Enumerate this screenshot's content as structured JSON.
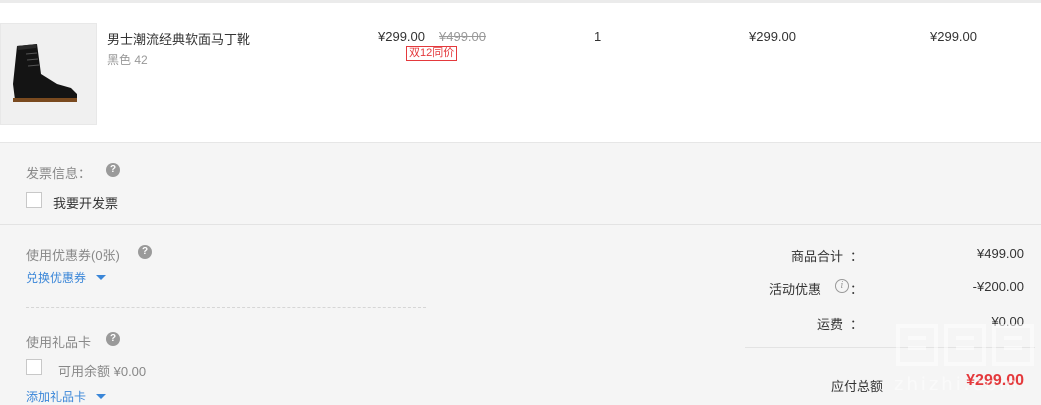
{
  "product": {
    "name": "男士潮流经典软面马丁靴",
    "spec": "黑色 42",
    "price_now": "¥299.00",
    "price_old": "¥499.00",
    "promo_tag": "双12同价",
    "quantity": "1",
    "unit_total": "¥299.00",
    "line_total": "¥299.00",
    "image_icon": "black-boot-image"
  },
  "invoice": {
    "title": "发票信息：",
    "help": "?",
    "checkbox_label": "我要开发票"
  },
  "coupon": {
    "title": "使用优惠券(0张)",
    "help": "?",
    "link": "兑换优惠券"
  },
  "gift_card": {
    "title": "使用礼品卡",
    "help": "?",
    "checkbox_label": "可用余额 ¥0.00",
    "link": "添加礼品卡"
  },
  "summary": {
    "goods_total_label": "商品合计",
    "goods_total_value": "¥499.00",
    "discount_label": "活动优惠",
    "discount_value": "-¥200.00",
    "shipping_label": "运费",
    "shipping_value": "¥0.00",
    "payable_label": "应付总额",
    "payable_value": "¥299.00",
    "colon": "："
  },
  "watermark": {
    "logo_text": "值值值",
    "domain_text": "zhizhi.com"
  },
  "colors": {
    "accent_red": "#e4393c",
    "link_blue": "#3a86d8",
    "panel_bg": "#f5f5f5"
  }
}
